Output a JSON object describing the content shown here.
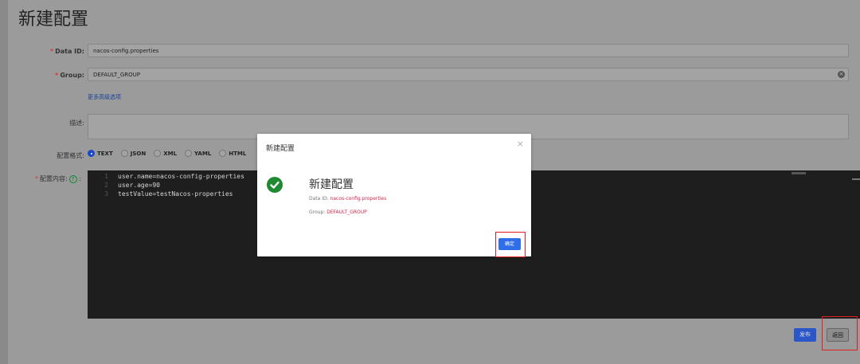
{
  "page": {
    "title": "新建配置"
  },
  "form": {
    "data_id": {
      "label": "Data ID:",
      "value": "nacos-config.properties"
    },
    "group": {
      "label": "Group:",
      "value": "DEFAULT_GROUP"
    },
    "more_options": "更多高级选项",
    "description": {
      "label": "描述:",
      "value": ""
    },
    "format": {
      "label": "配置格式:",
      "options": [
        "TEXT",
        "JSON",
        "XML",
        "YAML",
        "HTML"
      ],
      "selected": "TEXT"
    },
    "content": {
      "label": "配置内容:",
      "lines": [
        {
          "num": "1",
          "text": "user.name=nacos-config-properties"
        },
        {
          "num": "2",
          "text": "user.age=90"
        },
        {
          "num": "3",
          "text": "testValue=testNacos-properties"
        }
      ]
    }
  },
  "actions": {
    "publish": "发布",
    "back": "返回"
  },
  "modal": {
    "title": "新建配置",
    "heading": "新建配置",
    "data_id_label": "Data ID:",
    "data_id_value": "nacos-config.properties",
    "group_label": "Group:",
    "group_value": "DEFAULT_GROUP",
    "ok": "确定"
  },
  "colors": {
    "primary": "#2f6ee8",
    "success": "#1e8a32",
    "required": "#d63a3a",
    "highlight_box": "#e02020",
    "value_text": "#d6244a"
  }
}
